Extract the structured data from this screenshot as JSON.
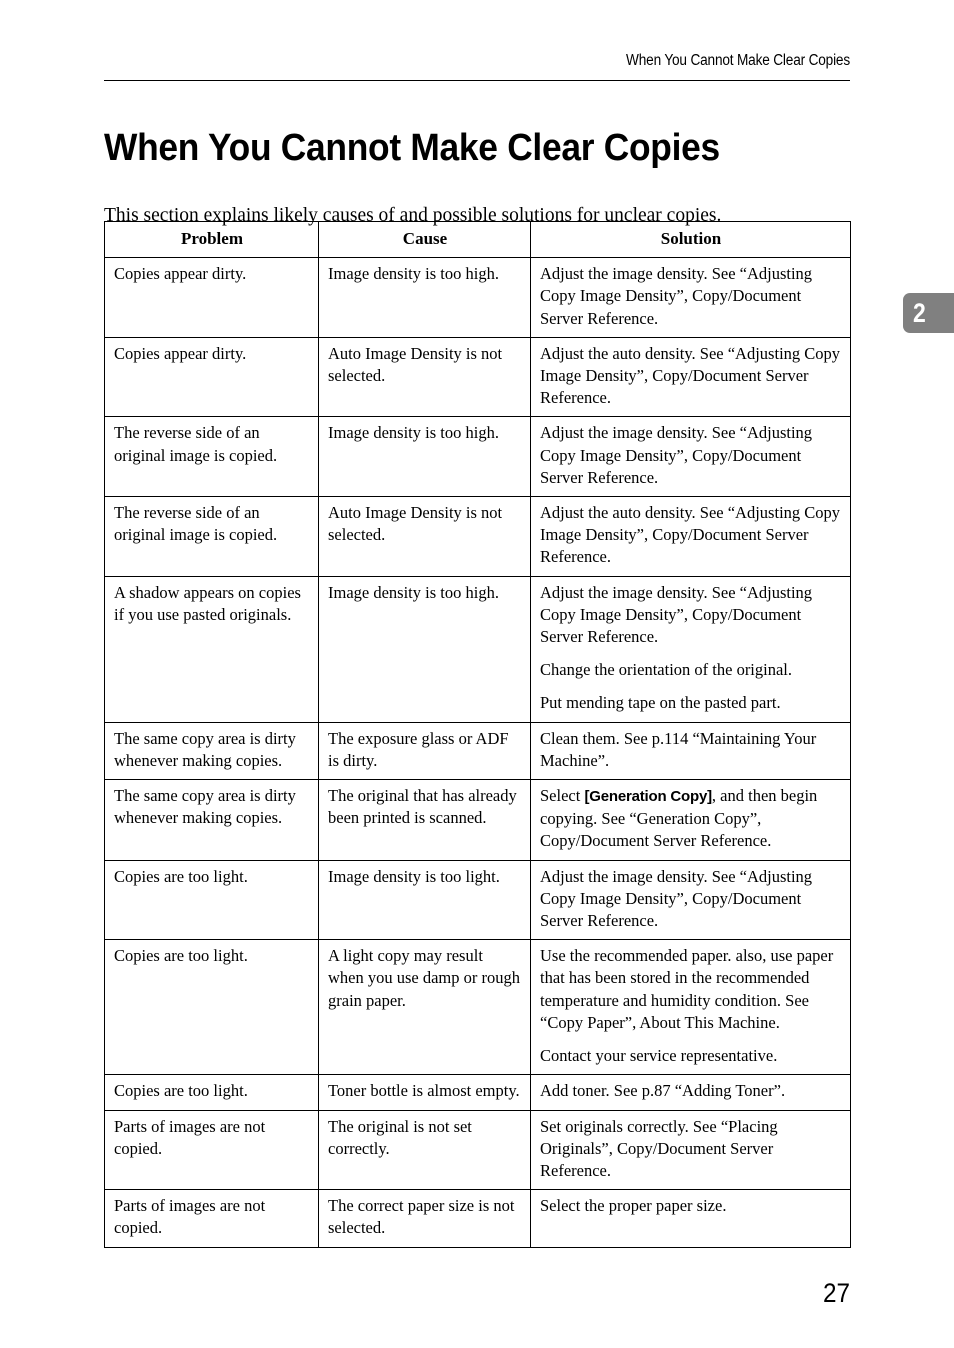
{
  "running_header": "When You Cannot Make Clear Copies",
  "chapter_tab": {
    "number": "2",
    "color": "#808080",
    "text_color": "#ffffff"
  },
  "page_title": "When You Cannot Make Clear Copies",
  "intro": "This section explains likely causes of and possible solutions for unclear copies.",
  "folio": "27",
  "table": {
    "headers": [
      "Problem",
      "Cause",
      "Solution"
    ],
    "rows": [
      {
        "problem": "Copies appear dirty.",
        "cause": "Image density is too high.",
        "solution": [
          "Adjust the image density. See “Adjusting Copy Image Density”, Copy/Document Server Reference."
        ]
      },
      {
        "problem": "Copies appear dirty.",
        "cause": "Auto Image Density is not selected.",
        "solution": [
          "Adjust the auto density. See “Adjusting Copy Image Density”, Copy/Document Server Reference."
        ]
      },
      {
        "problem": "The reverse side of an original image is copied.",
        "cause": "Image density is too high.",
        "solution": [
          "Adjust the image density. See “Adjusting Copy Image Density”, Copy/Document Server Reference."
        ]
      },
      {
        "problem": "The reverse side of an original image is copied.",
        "cause": "Auto Image Density is not selected.",
        "solution": [
          "Adjust the auto density. See “Adjusting Copy Image Density”, Copy/Document Server Reference."
        ]
      },
      {
        "problem": "A shadow appears on copies if you use pasted originals.",
        "cause": "Image density is too high.",
        "solution": [
          "Adjust the image density. See “Adjusting Copy Image Density”, Copy/Document Server Reference.",
          "Change the orientation of the original.",
          "Put mending tape on the pasted part."
        ]
      },
      {
        "problem": "The same copy area is dirty whenever making copies.",
        "cause": "The exposure glass or ADF is dirty.",
        "solution": [
          "Clean them. See p.114 “Maintaining Your Machine”."
        ]
      },
      {
        "problem": "The same copy area is dirty whenever making copies.",
        "cause": "The original that has already been printed is scanned.",
        "solution_rich": {
          "before": "Select ",
          "button": "[Generation Copy]",
          "after": ", and then begin copying. See “Generation Copy”, Copy/Document Server Reference."
        }
      },
      {
        "problem": "Copies are too light.",
        "cause": "Image density is too light.",
        "solution": [
          "Adjust the image density. See “Adjusting Copy Image Density”, Copy/Document Server Reference."
        ]
      },
      {
        "problem": "Copies are too light.",
        "cause": "A light copy may result when you use damp or rough grain paper.",
        "solution": [
          "Use the recommended paper. also, use paper that has been stored in the recommended temperature and humidity condition. See “Copy Paper”, About This Machine.",
          "Contact your service representative."
        ]
      },
      {
        "problem": "Copies are too light.",
        "cause": "Toner bottle is almost empty.",
        "solution": [
          "Add toner. See p.87 “Adding Toner”."
        ]
      },
      {
        "problem": "Parts of images are not copied.",
        "cause": "The original is not set correctly.",
        "solution": [
          "Set originals correctly. See “Placing Originals”, Copy/Document Server Reference."
        ]
      },
      {
        "problem": "Parts of images are not copied.",
        "cause": "The correct paper size is not selected.",
        "solution": [
          "Select the proper paper size."
        ]
      }
    ]
  }
}
